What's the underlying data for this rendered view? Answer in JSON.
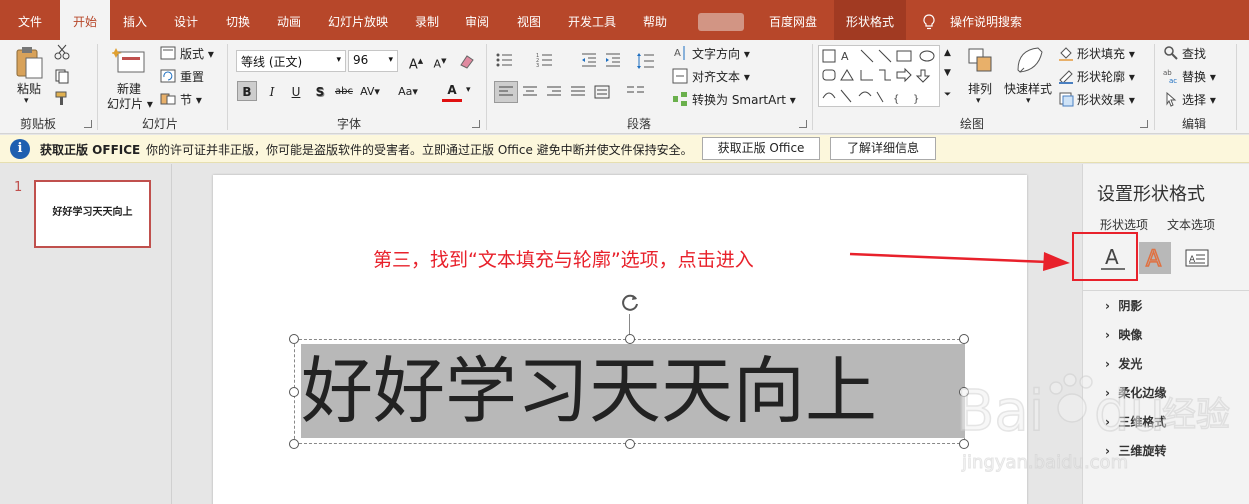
{
  "tabs": [
    {
      "label": "文件"
    },
    {
      "label": "开始"
    },
    {
      "label": "插入"
    },
    {
      "label": "设计"
    },
    {
      "label": "切换"
    },
    {
      "label": "动画"
    },
    {
      "label": "幻灯片放映"
    },
    {
      "label": "录制"
    },
    {
      "label": "审阅"
    },
    {
      "label": "视图"
    },
    {
      "label": "开发工具"
    },
    {
      "label": "帮助"
    },
    {
      "label": "百度网盘"
    },
    {
      "label": "形状格式"
    },
    {
      "label": "操作说明搜索"
    }
  ],
  "ribbon": {
    "clipboard": {
      "paste": "粘贴",
      "group": "剪贴板"
    },
    "slides": {
      "new_slide": "新建",
      "new_slide2": "幻灯片",
      "layout": "版式",
      "reset": "重置",
      "section": "节",
      "group": "幻灯片"
    },
    "font": {
      "family": "等线 (正文)",
      "size": "96",
      "group": "字体"
    },
    "paragraph": {
      "direction": "文字方向",
      "align": "对齐文本",
      "smartart": "转换为 SmartArt",
      "group": "段落"
    },
    "drawing": {
      "arrange": "排列",
      "quick_styles": "快速样式",
      "fill": "形状填充",
      "outline": "形状轮廓",
      "effects": "形状效果",
      "group": "绘图"
    },
    "editing": {
      "find": "查找",
      "replace": "替换",
      "select": "选择",
      "group": "编辑"
    }
  },
  "infobar": {
    "title": "获取正版 OFFICE",
    "message": "你的许可证并非正版，你可能是盗版软件的受害者。立即通过正版 Office 避免中断并使文件保持安全。",
    "btn_get": "获取正版 Office",
    "btn_more": "了解详细信息"
  },
  "thumbs": {
    "number": "1",
    "text": "好好学习天天向上"
  },
  "slide": {
    "instruction": "第三，找到“文本填充与轮廓”选项，点击进入",
    "text": "好好学习天天向上"
  },
  "pane": {
    "title": "设置形状格式",
    "tab_shape": "形状选项",
    "tab_text": "文本选项",
    "sections": [
      "阴影",
      "映像",
      "发光",
      "柔化边缘",
      "三维格式",
      "三维旋转"
    ]
  },
  "colors": {
    "accent": "#b7472a",
    "annotation": "#e8212b"
  }
}
